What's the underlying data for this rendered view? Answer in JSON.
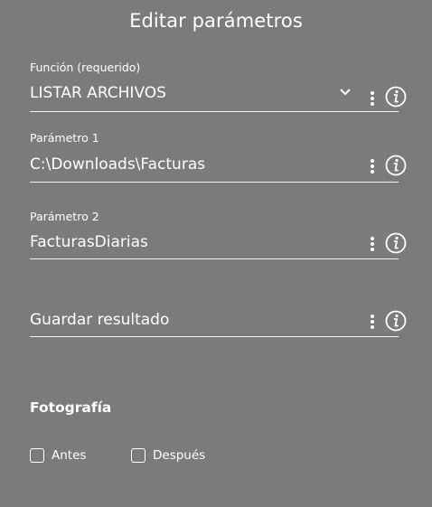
{
  "title": "Editar parámetros",
  "fields": [
    {
      "label": "Función (requerido)",
      "value": "LISTAR ARCHIVOS",
      "has_dropdown": true
    },
    {
      "label": "Parámetro 1",
      "value": "C:\\Downloads\\Facturas",
      "has_dropdown": false
    },
    {
      "label": "Parámetro 2",
      "value": "FacturasDiarias",
      "has_dropdown": false
    },
    {
      "label": "",
      "value": "Guardar resultado",
      "has_dropdown": false
    }
  ],
  "photo_section": {
    "heading": "Fotografía",
    "options": [
      {
        "label": "Antes",
        "checked": false
      },
      {
        "label": "Después",
        "checked": false
      }
    ]
  },
  "icons": {
    "dropdown": "chevron-down-icon",
    "menu": "kebab-menu-icon",
    "info": "info-icon"
  },
  "colors": {
    "background": "#7b7b7b",
    "text": "#ffffff"
  }
}
